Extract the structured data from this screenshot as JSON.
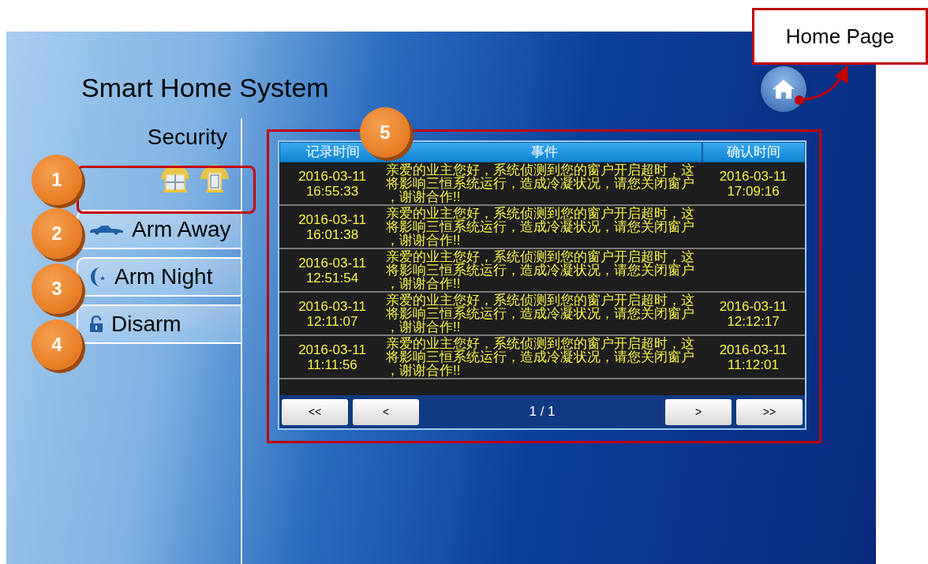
{
  "title": "Smart Home System",
  "section": "Security",
  "status_icons": [
    {
      "kind": "window"
    },
    {
      "kind": "door"
    }
  ],
  "mode_buttons": [
    {
      "kind": "car",
      "label": "Arm Away"
    },
    {
      "kind": "moon",
      "label": "Arm Night"
    },
    {
      "kind": "lock",
      "label": "Disarm"
    }
  ],
  "event_table": {
    "columns": [
      "记录时间",
      "事件",
      "确认时间"
    ],
    "rows": [
      {
        "recorded": "2016-03-11 16:55:33",
        "event": "亲爱的业主您好，系统侦测到您的窗户开启超时，这将影响三恒系统运行，造成冷凝状况，请您关闭窗户，谢谢合作!!",
        "confirmed": "2016-03-11 17:09:16"
      },
      {
        "recorded": "2016-03-11 16:01:38",
        "event": "亲爱的业主您好，系统侦测到您的窗户开启超时，这将影响三恒系统运行，造成冷凝状况，请您关闭窗户，谢谢合作!!"
      },
      {
        "recorded": "2016-03-11 12:51:54",
        "event": "亲爱的业主您好，系统侦测到您的窗户开启超时，这将影响三恒系统运行，造成冷凝状况，请您关闭窗户，谢谢合作!!"
      },
      {
        "recorded": "2016-03-11 12:11:07",
        "event": "亲爱的业主您好，系统侦测到您的窗户开启超时，这将影响三恒系统运行，造成冷凝状况，请您关闭窗户，谢谢合作!!",
        "confirmed": "2016-03-11 12:12:17"
      },
      {
        "recorded": "2016-03-11 11:11:56",
        "event": "亲爱的业主您好，系统侦测到您的窗户开启超时，这将影响三恒系统运行，造成冷凝状况，请您关闭窗户，谢谢合作!!",
        "confirmed": "2016-03-11 11:12:01"
      }
    ],
    "pager": {
      "buttons": [
        "<<",
        "<",
        ">",
        ">>"
      ],
      "page": "1 / 1"
    }
  },
  "annotations": {
    "markers": [
      "1",
      "2",
      "3",
      "4",
      "5"
    ],
    "home_callout": "Home Page"
  }
}
